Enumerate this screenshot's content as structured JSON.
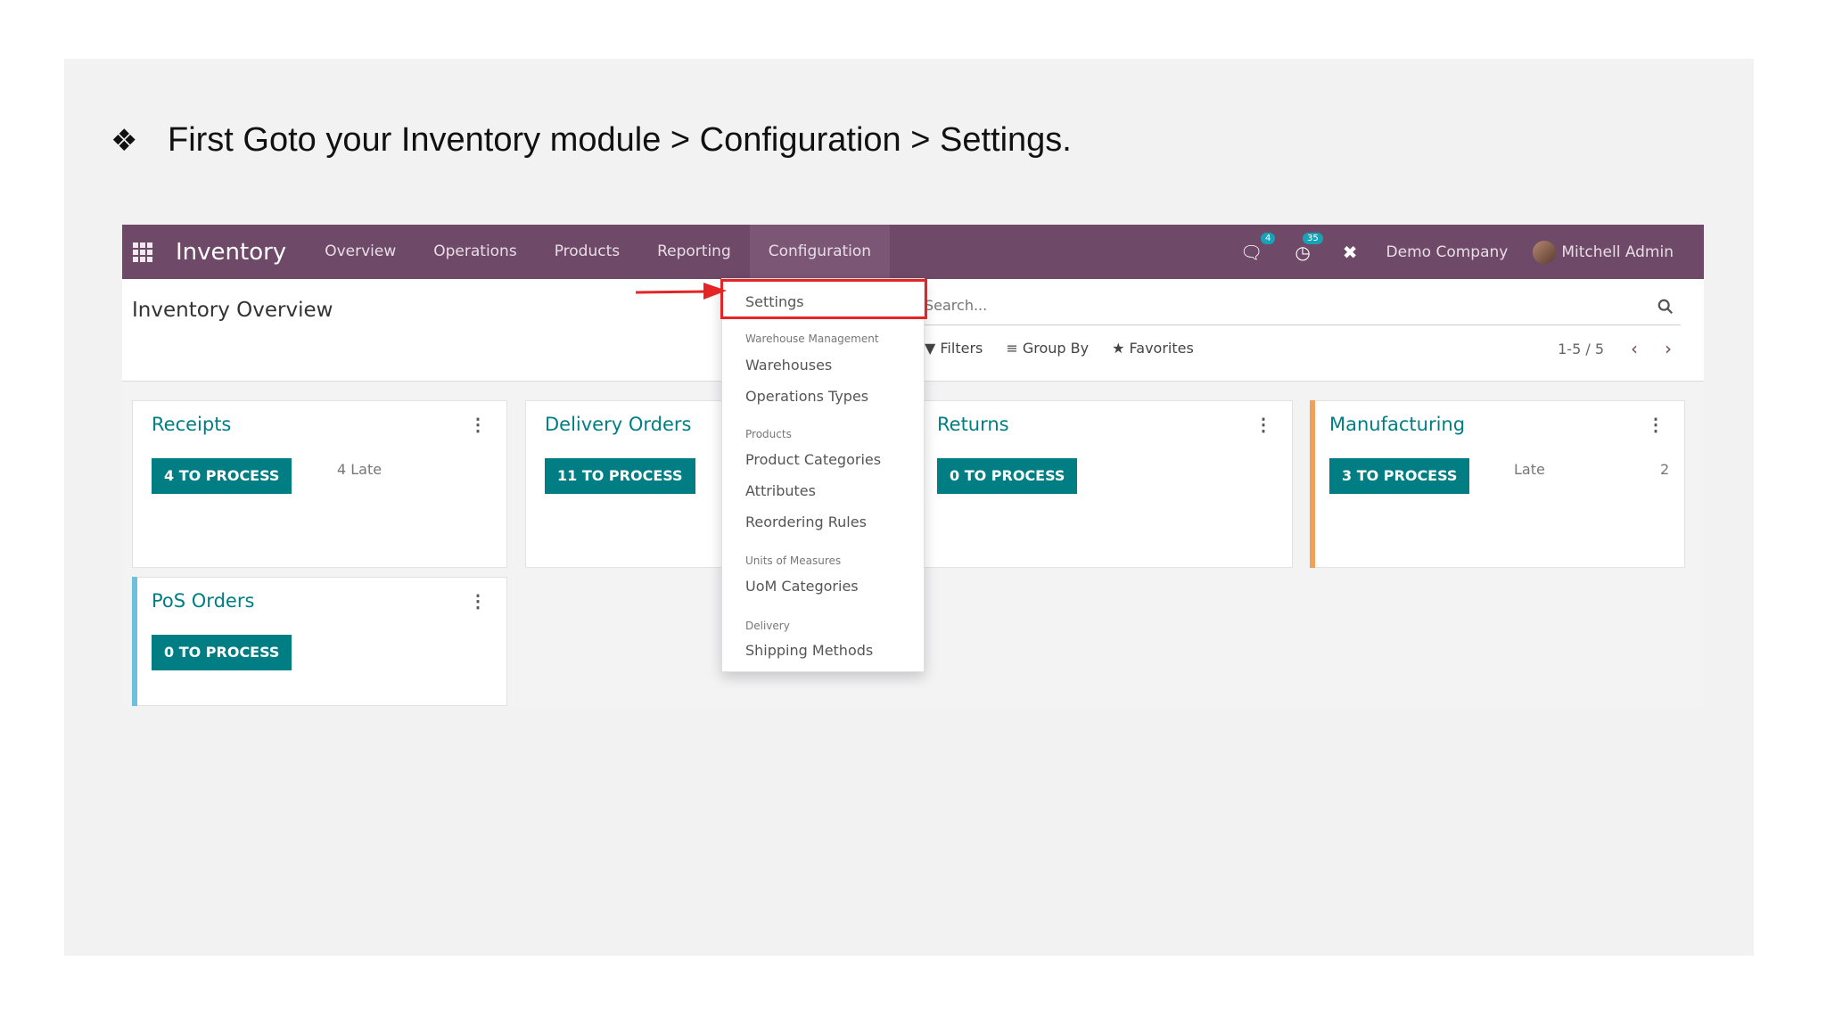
{
  "slide": {
    "bullet_glyph": "❖",
    "instruction": "First Goto your Inventory module > Configuration > Settings."
  },
  "navbar": {
    "app_name": "Inventory",
    "menu": [
      "Overview",
      "Operations",
      "Products",
      "Reporting",
      "Configuration"
    ],
    "active_menu": "Configuration",
    "chat_badge": "4",
    "activity_badge": "35",
    "company": "Demo Company",
    "user": "Mitchell Admin"
  },
  "control_panel": {
    "title": "Inventory Overview",
    "search_placeholder": "Search...",
    "filters_label": "Filters",
    "group_by_label": "Group By",
    "favorites_label": "Favorites",
    "pager": "1-5 / 5"
  },
  "dropdown": {
    "settings": "Settings",
    "sections": [
      {
        "header": "Warehouse Management",
        "items": [
          "Warehouses",
          "Operations Types"
        ]
      },
      {
        "header": "Products",
        "items": [
          "Product Categories",
          "Attributes",
          "Reordering Rules"
        ]
      },
      {
        "header": "Units of Measures",
        "items": [
          "UoM Categories"
        ]
      },
      {
        "header": "Delivery",
        "items": [
          "Shipping Methods"
        ]
      }
    ]
  },
  "cards": [
    {
      "title": "Receipts",
      "button": "4 TO PROCESS",
      "late": "4 Late",
      "late_count": ""
    },
    {
      "title": "Delivery Orders",
      "button": "11 TO PROCESS",
      "late": "",
      "late_count": ""
    },
    {
      "title": "Returns",
      "button": "0 TO PROCESS",
      "late": "",
      "late_count": ""
    },
    {
      "title": "Manufacturing",
      "button": "3 TO PROCESS",
      "late": "Late",
      "late_count": "2"
    },
    {
      "title": "PoS Orders",
      "button": "0 TO PROCESS",
      "late": "",
      "late_count": ""
    }
  ],
  "colors": {
    "navbar": "#6e4a68",
    "primary": "#017e84",
    "highlight": "#e52426",
    "manufacturing_accent": "#f0a05a",
    "pos_accent": "#6cc0dc"
  }
}
